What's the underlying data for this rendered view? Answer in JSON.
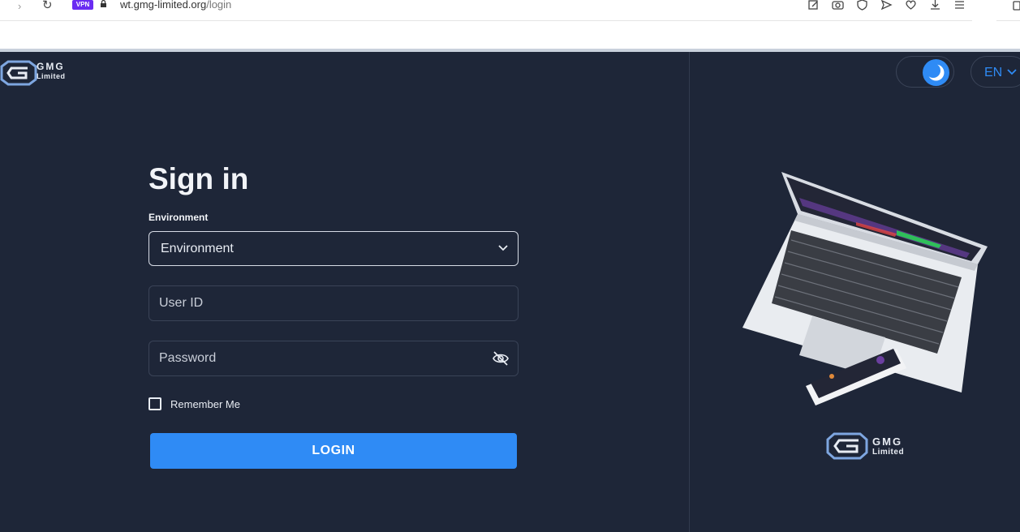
{
  "browser": {
    "vpn_badge": "VPN",
    "url_domain": "wt.gmg-limited.org",
    "url_path": "/login"
  },
  "brand": {
    "name": "GMG",
    "sub": "Limited"
  },
  "header": {
    "theme_icon": "moon-icon",
    "language": "EN"
  },
  "login": {
    "title": "Sign in",
    "environment_label": "Environment",
    "environment_selected": "Environment",
    "user_id_placeholder": "User ID",
    "password_placeholder": "Password",
    "remember_label": "Remember Me",
    "login_button": "LOGIN"
  },
  "colors": {
    "background": "#1e2638",
    "accent": "#2f8bf5",
    "text": "#f2f4f8"
  }
}
